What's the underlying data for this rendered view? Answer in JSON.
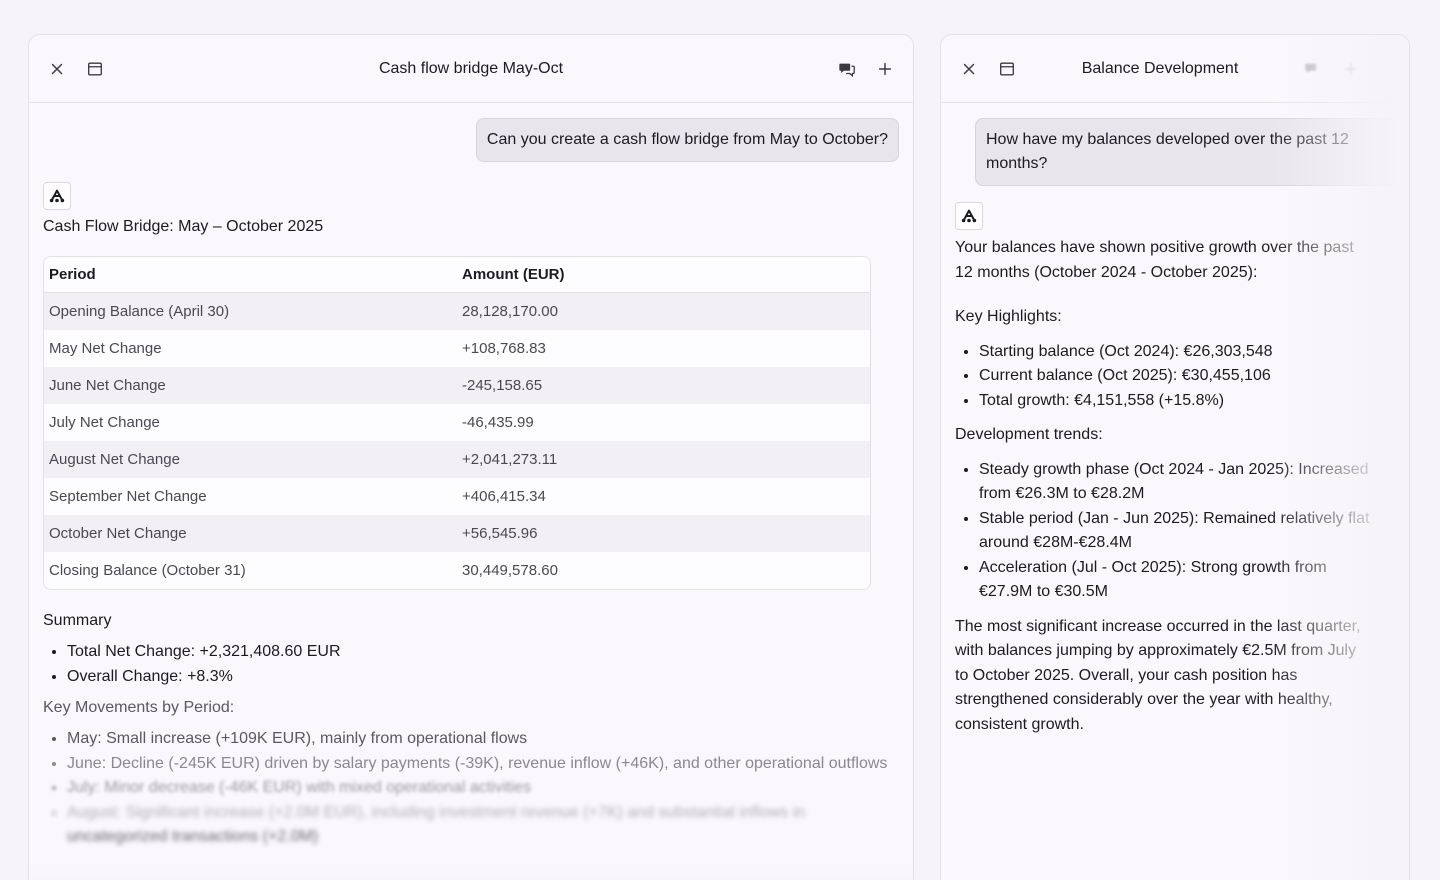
{
  "left_panel": {
    "title": "Cash flow bridge May-Oct",
    "user_message": "Can you create a cash flow bridge from May to October?",
    "response_title": "Cash Flow Bridge: May – October 2025",
    "table": {
      "headers": [
        "Period",
        "Amount (EUR)"
      ],
      "rows": [
        [
          "Opening Balance (April 30)",
          "28,128,170.00"
        ],
        [
          "May Net Change",
          "+108,768.83"
        ],
        [
          "June Net Change",
          "-245,158.65"
        ],
        [
          "July Net Change",
          "-46,435.99"
        ],
        [
          "August Net Change",
          "+2,041,273.11"
        ],
        [
          "September Net Change",
          "+406,415.34"
        ],
        [
          "October Net Change",
          "+56,545.96"
        ],
        [
          "Closing Balance (October 31)",
          "30,449,578.60"
        ]
      ]
    },
    "summary_heading": "Summary",
    "summary_items": [
      "Total Net Change: +2,321,408.60 EUR",
      "Overall Change: +8.3%"
    ],
    "movements_heading": "Key Movements by Period:",
    "movement_items": [
      "May: Small increase (+109K EUR), mainly from operational flows",
      "June: Decline (-245K EUR) driven by salary payments (-39K), revenue inflow (+46K), and other operational outflows",
      "July: Minor decrease (-46K EUR) with mixed operational activities",
      "August: Significant increase (+2.0M EUR), including investment revenue (+7K) and substantial inflows in",
      "uncategorized transactions (+2.0M)"
    ]
  },
  "right_panel": {
    "title": "Balance Development",
    "user_message": "How have my balances developed over the past 12 months?",
    "intro": "Your balances have shown positive growth over the past 12 months (October 2024 - October 2025):",
    "highlights_heading": "Key Highlights:",
    "highlights": [
      "Starting balance (Oct 2024): €26,303,548",
      "Current balance (Oct 2025): €30,455,106",
      "Total growth: €4,151,558 (+15.8%)"
    ],
    "trends_heading": "Development trends:",
    "trends": [
      "Steady growth phase (Oct 2024 - Jan 2025): Increased from €26.3M to €28.2M",
      "Stable period (Jan - Jun 2025): Remained relatively flat around €28M-€28.4M",
      "Acceleration (Jul - Oct 2025): Strong growth from €27.9M to €30.5M"
    ],
    "conclusion": "The most significant increase occurred in the last quarter, with balances jumping by approximately €2.5M from July to October 2025. Overall, your cash position has strengthened considerably over the year with healthy, consistent growth."
  },
  "icons": {
    "close": "close-icon",
    "window": "window-icon",
    "chat": "chat-bubbles-icon",
    "add": "plus-icon",
    "assistant": "assistant-logo-icon"
  }
}
